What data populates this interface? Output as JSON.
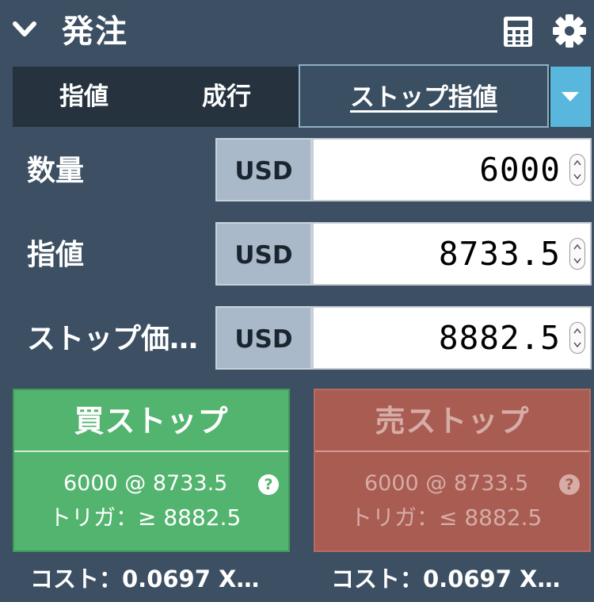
{
  "header": {
    "title": "発注",
    "icons": [
      "chevron-down-icon",
      "calculator-icon",
      "gear-icon"
    ]
  },
  "tabs": [
    {
      "label": "指値",
      "active": false
    },
    {
      "label": "成行",
      "active": false
    },
    {
      "label": "ストップ指値",
      "active": true
    }
  ],
  "fields": {
    "quantity": {
      "label": "数量",
      "unit": "USD",
      "value": "6000"
    },
    "limit": {
      "label": "指値",
      "unit": "USD",
      "value": "8733.5"
    },
    "stop": {
      "label": "ストップ価…",
      "unit": "USD",
      "value": "8882.5"
    }
  },
  "buy": {
    "title": "買ストップ",
    "line1": "6000 @ 8733.5",
    "line2": "トリガ：≥ 8882.5",
    "cost": "コスト：0.0697 X…"
  },
  "sell": {
    "title": "売ストップ",
    "line1": "6000 @ 8733.5",
    "line2": "トリガ：≤ 8882.5",
    "cost": "コスト：0.0697 X…"
  },
  "help_glyph": "?",
  "colors": {
    "background": "#3d4f63",
    "buy": "#52b46e",
    "sell": "#a85c52",
    "dropdown_accent": "#59b7de"
  }
}
